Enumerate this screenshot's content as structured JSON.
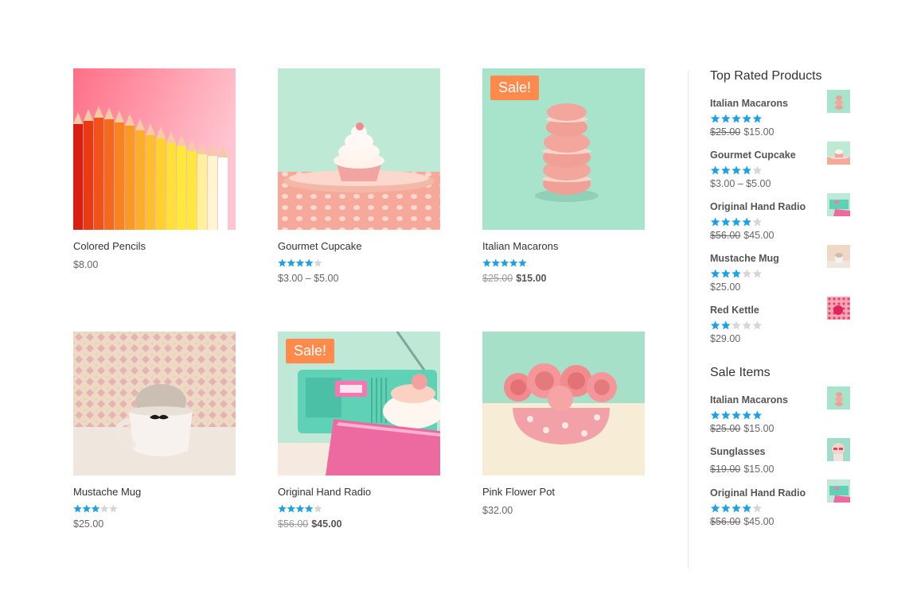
{
  "products": [
    {
      "name": "Colored Pencils",
      "price": "$8.00",
      "rating": 0,
      "sale": false
    },
    {
      "name": "Gourmet Cupcake",
      "price": "$3.00 – $5.00",
      "rating": 4,
      "sale": false
    },
    {
      "name": "Italian Macarons",
      "old_price": "$25.00",
      "price": "$15.00",
      "rating": 5,
      "sale": true,
      "sale_label": "Sale!"
    },
    {
      "name": "Mustache Mug",
      "price": "$25.00",
      "rating": 3,
      "sale": false
    },
    {
      "name": "Original Hand Radio",
      "old_price": "$56.00",
      "price": "$45.00",
      "rating": 4,
      "sale": true,
      "sale_label": "Sale!"
    },
    {
      "name": "Pink Flower Pot",
      "price": "$32.00",
      "rating": 0,
      "sale": false
    }
  ],
  "top_rated": {
    "title": "Top Rated Products",
    "items": [
      {
        "name": "Italian Macarons",
        "old_price": "$25.00",
        "price": "$15.00",
        "rating": 5
      },
      {
        "name": "Gourmet Cupcake",
        "price": "$3.00 – $5.00",
        "rating": 4
      },
      {
        "name": "Original Hand Radio",
        "old_price": "$56.00",
        "price": "$45.00",
        "rating": 4
      },
      {
        "name": "Mustache Mug",
        "price": "$25.00",
        "rating": 3
      },
      {
        "name": "Red Kettle",
        "price": "$29.00",
        "rating": 2
      }
    ]
  },
  "sale_items": {
    "title": "Sale Items",
    "items": [
      {
        "name": "Italian Macarons",
        "old_price": "$25.00",
        "price": "$15.00",
        "rating": 5
      },
      {
        "name": "Sunglasses",
        "old_price": "$19.00",
        "price": "$15.00",
        "rating": 0
      },
      {
        "name": "Original Hand Radio",
        "old_price": "$56.00",
        "price": "$45.00",
        "rating": 4
      }
    ]
  },
  "colors": {
    "star_filled": "#1da1e6",
    "star_empty": "#d6d6d6",
    "sale_badge": "#ff8a4c",
    "divider": "#e5e5e5"
  },
  "icons": {
    "star": "star-icon"
  }
}
